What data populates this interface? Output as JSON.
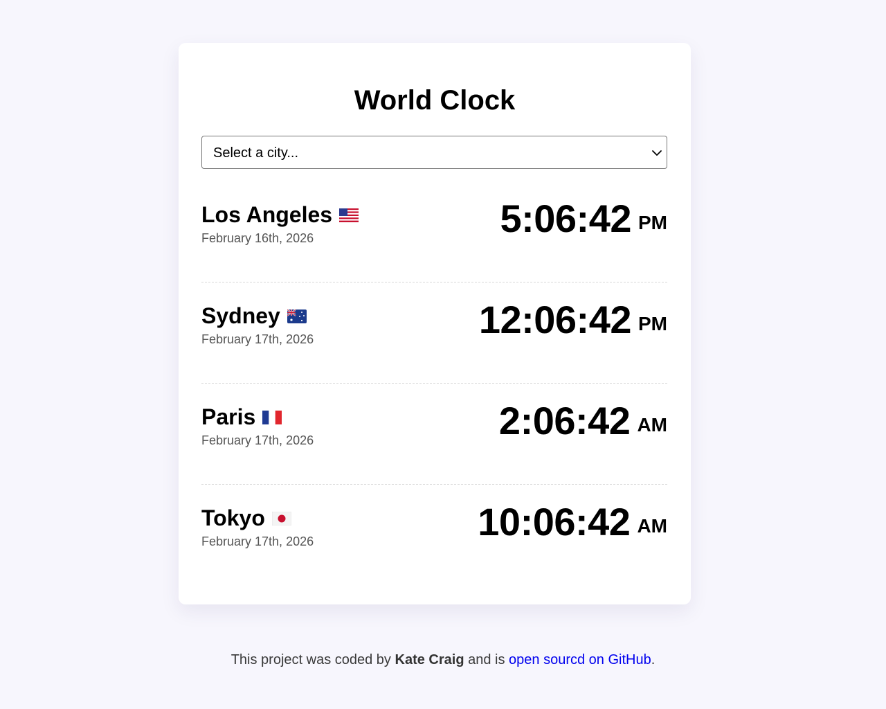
{
  "app": {
    "title": "World Clock"
  },
  "city_select": {
    "placeholder": "Select a city...",
    "icon": "chevron-down-icon"
  },
  "cities": [
    {
      "name": "Los Angeles",
      "flag": "us-flag",
      "date": "February 16th, 2026",
      "time": "5:06:42",
      "ampm": "PM"
    },
    {
      "name": "Sydney",
      "flag": "australia-flag",
      "date": "February 17th, 2026",
      "time": "12:06:42",
      "ampm": "PM"
    },
    {
      "name": "Paris",
      "flag": "france-flag",
      "date": "February 17th, 2026",
      "time": "2:06:42",
      "ampm": "AM"
    },
    {
      "name": "Tokyo",
      "flag": "japan-flag",
      "date": "February 17th, 2026",
      "time": "10:06:42",
      "ampm": "AM"
    }
  ],
  "footer": {
    "prefix": "This project was coded by",
    "author": "Kate Craig",
    "middle": "and is",
    "link_text": "open sourcd on GitHub",
    "suffix": "."
  },
  "colors": {
    "background": "#f7f6fd",
    "card": "#ffffff",
    "link": "#0000ee",
    "date_text": "#555555"
  }
}
